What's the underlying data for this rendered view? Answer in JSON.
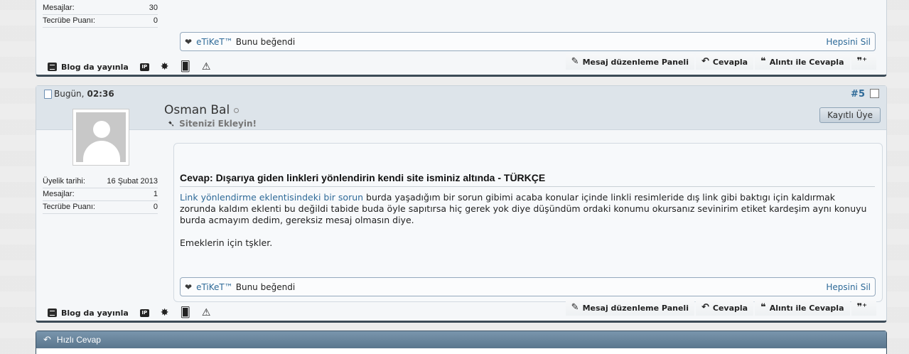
{
  "prev_post": {
    "stats": [
      {
        "label": "Mesajlar:",
        "value": "30"
      },
      {
        "label": "Tecrübe Puanı:",
        "value": "0"
      }
    ],
    "likes": {
      "liker": "eTiKeT™",
      "text": "Bunu beğendi",
      "remove_all": "Hepsini Sil"
    }
  },
  "footer": {
    "blog": "Blog da yayınla",
    "ip_icon": "IP",
    "edit_panel": "Mesaj düzenleme Paneli",
    "reply": "Cevapla",
    "quote_reply": "Alıntı ile Cevapla"
  },
  "post5": {
    "date_label": "Bugün,",
    "time": "02:36",
    "number": "#5",
    "username": "Osman Bal",
    "user_title": "Sitenizi Ekleyin!",
    "rank": "Kayıtlı Üye",
    "stats": [
      {
        "label": "Üyelik tarihi:",
        "value": "16 Şubat 2013"
      },
      {
        "label": "Mesajlar:",
        "value": "1"
      },
      {
        "label": "Tecrübe Puanı:",
        "value": "0"
      }
    ],
    "title": "Cevap: Dışarıya giden linkleri yönlendirin kendi site isminiz altında - TÜRKÇE",
    "body_link": "Link yönlendirme eklentisindeki bir sorun",
    "body_text": " burda yaşadığım bir sorun gibimi acaba konular içinde linkli resimleride dış link gibi baktıgı için kaldırmak zorunda kaldım eklenti bu değildi tabide buda öyle sapıtırsa hiç gerek yok diye düşündüm ordaki konumu okursanız sevinirim etiket kardeşim aynı konuyu burda acmayım dedim, gereksiz mesaj olmasın diye.",
    "body_thanks": "Emeklerin için tşkler.",
    "likes": {
      "liker": "eTiKeT™",
      "text": "Bunu beğendi",
      "remove_all": "Hepsini Sil"
    }
  },
  "quick_reply": {
    "title": "Hızlı Cevap"
  }
}
